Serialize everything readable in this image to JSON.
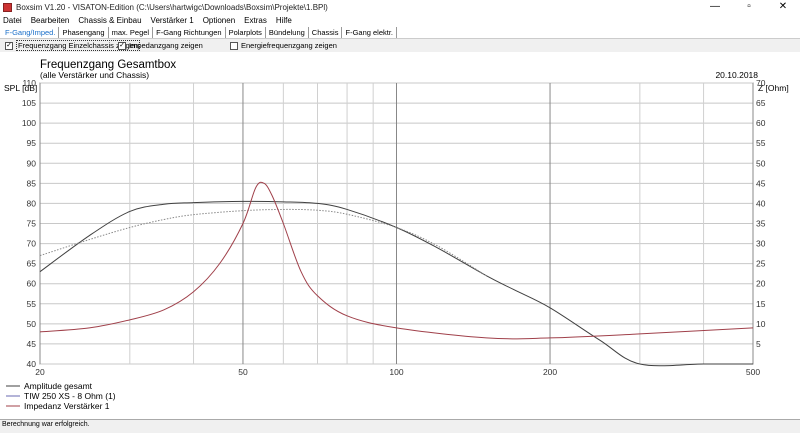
{
  "window": {
    "title": "Boxsim V1.20 - VISATON-Edition (C:\\Users\\hartwigc\\Downloads\\Boxsim\\Projekte\\1.BPl)",
    "min": "—",
    "max": "▫",
    "close": "✕"
  },
  "menu": [
    "Datei",
    "Bearbeiten",
    "Chassis & Einbau",
    "Verstärker 1",
    "Optionen",
    "Extras",
    "Hilfe"
  ],
  "tabs": [
    "F-Gang/Imped.",
    "Phasengang",
    "max. Pegel",
    "F-Gang Richtungen",
    "Polarplots",
    "Bündelung",
    "Chassis",
    "F-Gang elektr."
  ],
  "checkboxes": [
    {
      "label": "Frequenzgang Einzelchassis zeigen",
      "checked": true
    },
    {
      "label": "Impedanzgang zeigen",
      "checked": true
    },
    {
      "label": "Energiefrequenzgang zeigen",
      "checked": false
    }
  ],
  "status": "Berechnung war erfolgreich.",
  "colors": {
    "amplitude": "#404040",
    "driver": "#6a6ab0",
    "impedance": "#a0404a",
    "grid": "#c8c8c8"
  },
  "chart_data": {
    "type": "line",
    "title": "Frequenzgang Gesamtbox",
    "subtitle": "(alle Verstärker und Chassis)",
    "date": "20.10.2018",
    "ylabel": "SPL [dB]",
    "y2label": "Z [Ohm]",
    "xscale": "log",
    "xlim": [
      20,
      500
    ],
    "ylim": [
      40,
      110
    ],
    "y2lim": [
      0,
      70
    ],
    "xticks": [
      20,
      50,
      100,
      200,
      500
    ],
    "yticks": [
      40,
      45,
      50,
      55,
      60,
      65,
      70,
      75,
      80,
      85,
      90,
      95,
      100,
      105,
      110
    ],
    "y2ticks": [
      5,
      10,
      15,
      20,
      25,
      30,
      35,
      40,
      45,
      50,
      55,
      60,
      65,
      70
    ],
    "series": [
      {
        "name": "Amplitude gesamt",
        "axis": "left",
        "x": [
          20,
          25,
          30,
          35,
          40,
          50,
          60,
          70,
          80,
          100,
          120,
          150,
          170,
          200,
          250,
          300,
          400,
          500
        ],
        "y": [
          63,
          72,
          78,
          79.8,
          80.2,
          80.5,
          80.4,
          80,
          78.5,
          74,
          69,
          62,
          58.5,
          54,
          46,
          40,
          38,
          38
        ]
      },
      {
        "name": "TIW 250 XS - 8 Ohm (1)",
        "axis": "left",
        "dashed": true,
        "x": [
          20,
          25,
          30,
          35,
          40,
          50,
          60,
          70,
          80,
          100,
          120,
          150
        ],
        "y": [
          67,
          71,
          74,
          76,
          77.2,
          78.2,
          78.5,
          78.3,
          77.3,
          74,
          69.5,
          62
        ]
      },
      {
        "name": "Impedanz Verstärker 1",
        "axis": "right",
        "x": [
          20,
          25,
          30,
          35,
          40,
          45,
          50,
          53,
          55,
          57,
          60,
          65,
          70,
          80,
          100,
          150,
          200,
          300,
          500
        ],
        "y": [
          8,
          9,
          11,
          13.5,
          18,
          25,
          35,
          44,
          45,
          42,
          35,
          23,
          17,
          12,
          9,
          6.5,
          6.5,
          7.5,
          9
        ]
      }
    ]
  }
}
